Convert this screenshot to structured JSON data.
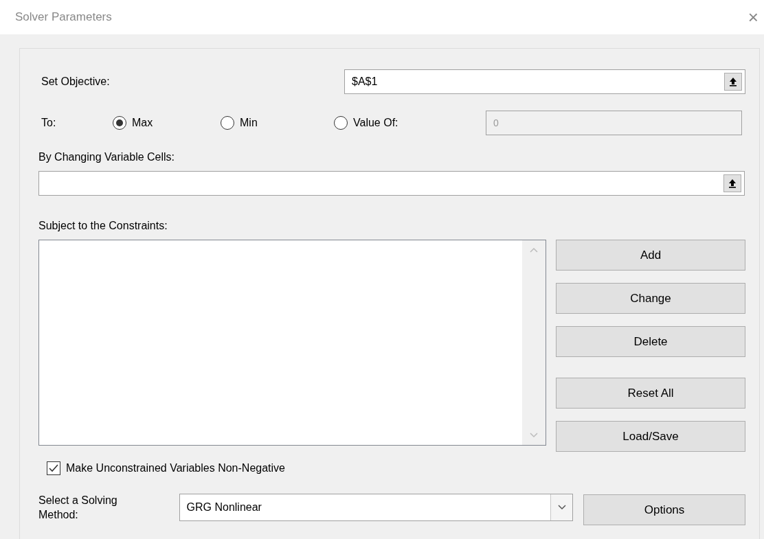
{
  "window": {
    "title": "Solver Parameters",
    "close": "×"
  },
  "objective": {
    "label": "Set Objective:",
    "value": "$A$1"
  },
  "to": {
    "label": "To:",
    "options": [
      {
        "label": "Max",
        "selected": true
      },
      {
        "label": "Min",
        "selected": false
      },
      {
        "label": "Value Of:",
        "selected": false
      }
    ],
    "value_of": {
      "value": "0",
      "disabled": true
    }
  },
  "variable_cells": {
    "label": "By Changing Variable Cells:"
  },
  "constraints": {
    "label": "Subject to the Constraints:"
  },
  "constraint_buttons": [
    {
      "label": "Add"
    },
    {
      "label": "Change"
    },
    {
      "label": "Delete"
    },
    {
      "label": "Reset All"
    },
    {
      "label": "Load/Save"
    }
  ],
  "non_negative": {
    "label": "Make Unconstrained Variables Non-Negative",
    "checked": true
  },
  "solving_method": {
    "label": "Select a Solving Method:",
    "value": "GRG Nonlinear"
  },
  "options_button": {
    "label": "Options"
  }
}
